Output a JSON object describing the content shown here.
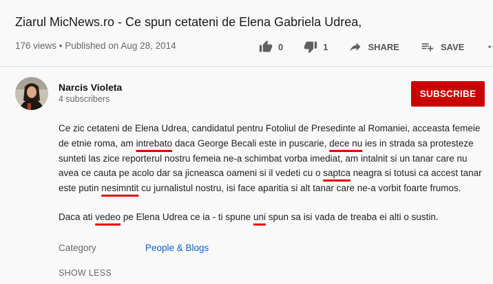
{
  "video": {
    "title": "Ziarul MicNews.ro - Ce spun cetateni de Elena Gabriela Udrea,",
    "meta": "176 views • Published on Aug 28, 2014"
  },
  "actions": {
    "likes": "0",
    "dislikes": "1",
    "share_label": "SHARE",
    "save_label": "SAVE",
    "more_icon": "more-horizontal-icon"
  },
  "channel": {
    "name": "Narcis Violeta",
    "subscribers": "4 subscribers",
    "subscribe_label": "SUBSCRIBE"
  },
  "description": {
    "paragraph1": [
      {
        "t": "Ce zic cetateni de Elena Udrea, candidatul pentru Fotoliul de Presedinte al Romaniei, acceasta femeie de etnie roma, am "
      },
      {
        "t": "intrebato",
        "u": true
      },
      {
        "t": " daca George Becali este in puscarie, "
      },
      {
        "t": "dece nu",
        "u": true
      },
      {
        "t": " ies in strada sa protesteze sunteti las zice reporterul nostru femeia ne-a schimbat vorba imediat, am intalnit si un tanar care nu avea ce cauta pe acolo dar sa jicneasca oameni si il vedeti cu o "
      },
      {
        "t": "saptca",
        "u": true
      },
      {
        "t": " neagra si totusi ca accest tanar este putin "
      },
      {
        "t": "nesimntit",
        "u": true
      },
      {
        "t": " cu jurnalistul nostru, isi face aparitia si alt tanar care ne-a vorbit foarte frumos."
      }
    ],
    "paragraph2": [
      {
        "t": "Daca ati "
      },
      {
        "t": "vedeo",
        "u": true
      },
      {
        "t": " pe Elena Udrea ce ia - ti spune "
      },
      {
        "t": "uni",
        "u": true
      },
      {
        "t": " spun sa isi vada de treaba ei alti o sustin."
      }
    ]
  },
  "category": {
    "label": "Category",
    "value": "People & Blogs"
  },
  "show_less_label": "SHOW LESS",
  "colors": {
    "subscribe": "#cc0000",
    "link": "#065fd4",
    "underline": "#e00000"
  }
}
